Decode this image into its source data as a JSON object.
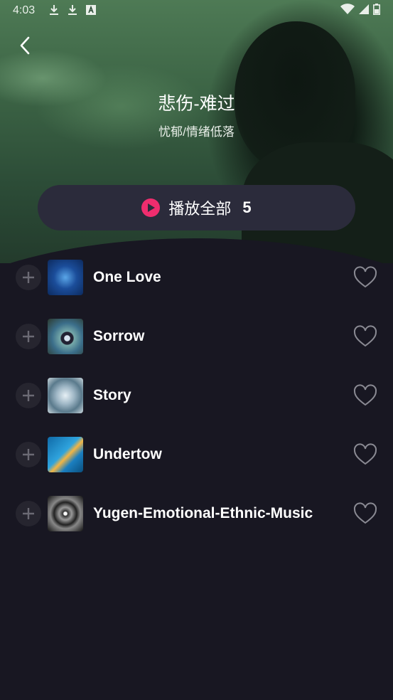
{
  "status_bar": {
    "time": "4:03",
    "icons_left": [
      "download-icon",
      "download-icon",
      "text-a-icon"
    ],
    "icons_right": [
      "wifi-icon",
      "signal-icon",
      "battery-icon"
    ]
  },
  "header": {
    "title": "悲伤-难过",
    "subtitle": "忧郁/情绪低落"
  },
  "play_all": {
    "label": "播放全部",
    "count": "5",
    "accent_color": "#ef2d6e"
  },
  "songs": [
    {
      "title": "One Love"
    },
    {
      "title": "Sorrow"
    },
    {
      "title": "Story"
    },
    {
      "title": "Undertow"
    },
    {
      "title": "Yugen-Emotional-Ethnic-Music"
    }
  ],
  "colors": {
    "background": "#181722",
    "button_bg": "#2b2b3b"
  }
}
